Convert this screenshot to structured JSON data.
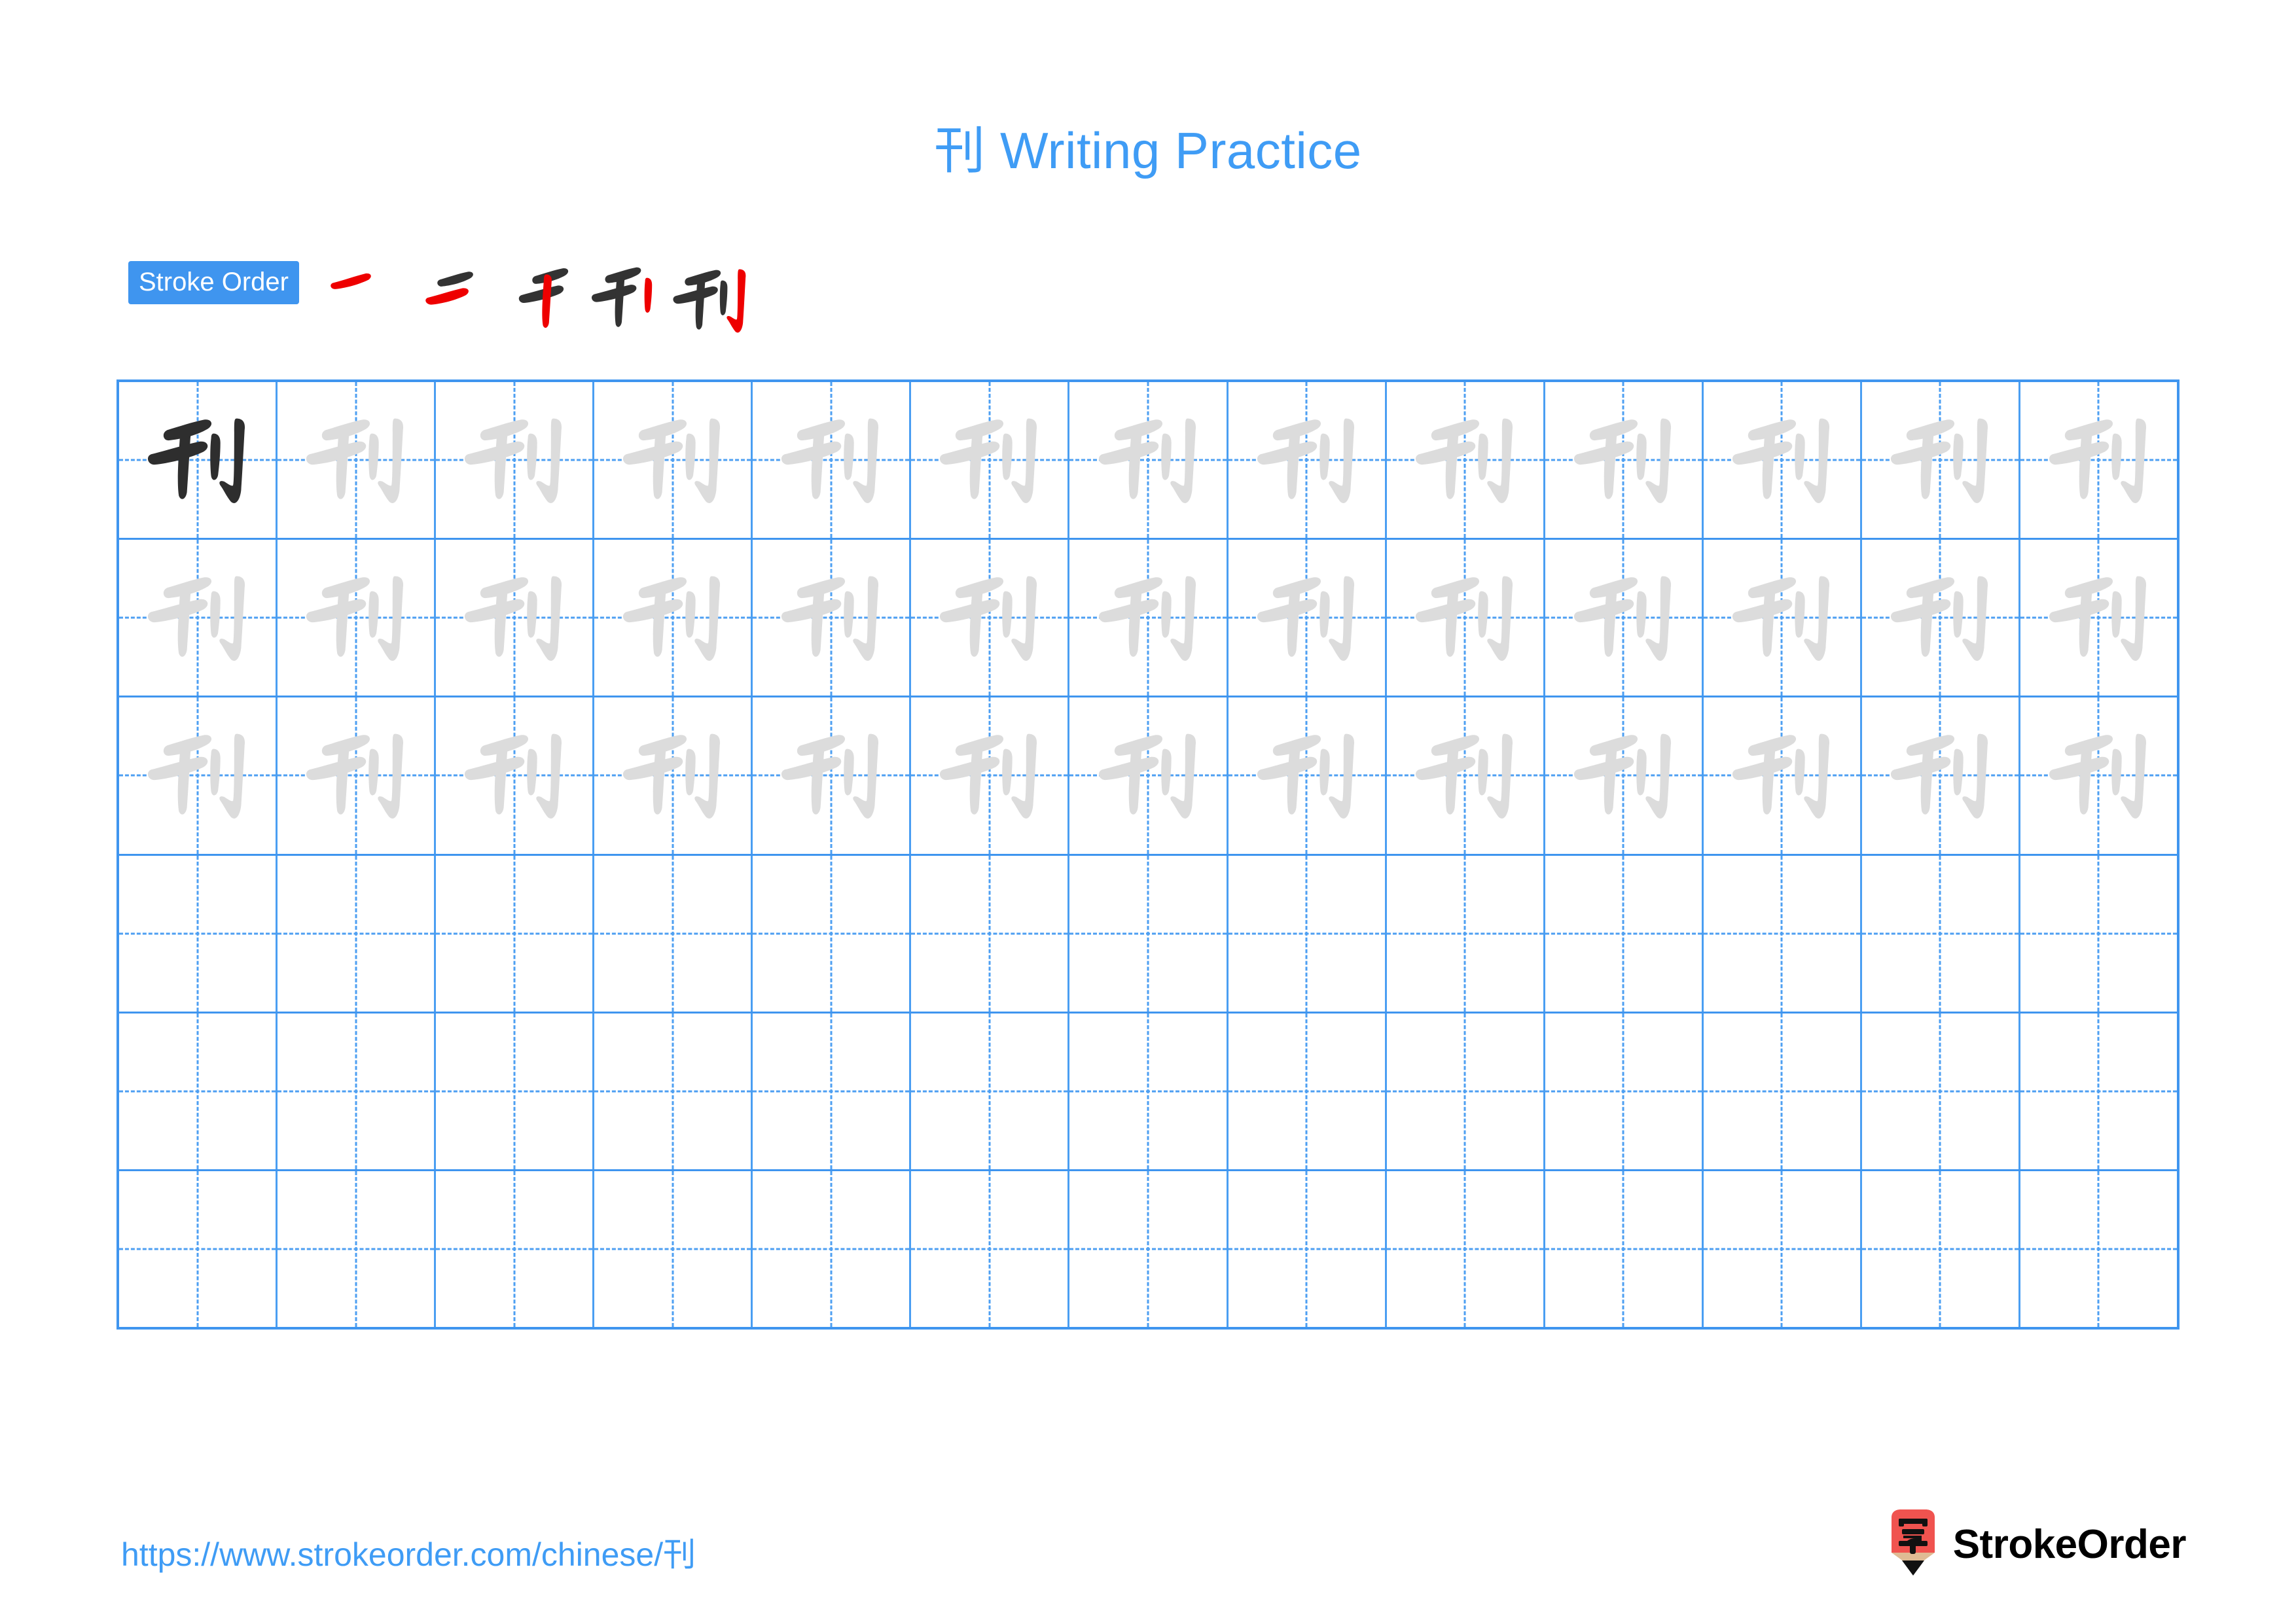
{
  "page": {
    "character": "刊",
    "title": "刊 Writing Practice",
    "title_color": "#3f9cf5",
    "background": "#ffffff"
  },
  "stroke_order": {
    "badge_label": "Stroke Order",
    "badge_bg": "#3f95ef",
    "badge_text_color": "#ffffff",
    "new_stroke_color": "#ee0000",
    "existing_stroke_color": "#333333",
    "stroke_count": 5,
    "steps": [
      {
        "index": 1,
        "strokes_shown": 1,
        "new_stroke": "heng (横) — top horizontal"
      },
      {
        "index": 2,
        "strokes_shown": 2,
        "new_stroke": "heng (横) — second horizontal"
      },
      {
        "index": 3,
        "strokes_shown": 3,
        "new_stroke": "shu (竖) — vertical of 干"
      },
      {
        "index": 4,
        "strokes_shown": 4,
        "new_stroke": "shu (竖) — short left vertical of 刂"
      },
      {
        "index": 5,
        "strokes_shown": 5,
        "new_stroke": "shugou (竖钩) — right vertical hook"
      }
    ]
  },
  "grid": {
    "columns": 13,
    "rows": 6,
    "line_color": "#3f95ef",
    "guide_line_color": "#4d9ff2",
    "traced_glyph_color": "#dcdcdc",
    "model_glyph_color": "#2e2e2e",
    "rows_data": [
      {
        "row": 1,
        "cells": [
          "model",
          "trace",
          "trace",
          "trace",
          "trace",
          "trace",
          "trace",
          "trace",
          "trace",
          "trace",
          "trace",
          "trace",
          "trace"
        ]
      },
      {
        "row": 2,
        "cells": [
          "trace",
          "trace",
          "trace",
          "trace",
          "trace",
          "trace",
          "trace",
          "trace",
          "trace",
          "trace",
          "trace",
          "trace",
          "trace"
        ]
      },
      {
        "row": 3,
        "cells": [
          "trace",
          "trace",
          "trace",
          "trace",
          "trace",
          "trace",
          "trace",
          "trace",
          "trace",
          "trace",
          "trace",
          "trace",
          "trace"
        ]
      },
      {
        "row": 4,
        "cells": [
          "empty",
          "empty",
          "empty",
          "empty",
          "empty",
          "empty",
          "empty",
          "empty",
          "empty",
          "empty",
          "empty",
          "empty",
          "empty"
        ]
      },
      {
        "row": 5,
        "cells": [
          "empty",
          "empty",
          "empty",
          "empty",
          "empty",
          "empty",
          "empty",
          "empty",
          "empty",
          "empty",
          "empty",
          "empty",
          "empty"
        ]
      },
      {
        "row": 6,
        "cells": [
          "empty",
          "empty",
          "empty",
          "empty",
          "empty",
          "empty",
          "empty",
          "empty",
          "empty",
          "empty",
          "empty",
          "empty",
          "empty"
        ]
      }
    ]
  },
  "footer": {
    "url": "https://www.strokeorder.com/chinese/刊",
    "url_color": "#3f9cf5",
    "brand_name": "StrokeOrder",
    "logo_character": "字",
    "logo_body_color": "#f0534f",
    "logo_wood_color": "#dfbb94",
    "logo_tip_color": "#111111"
  }
}
